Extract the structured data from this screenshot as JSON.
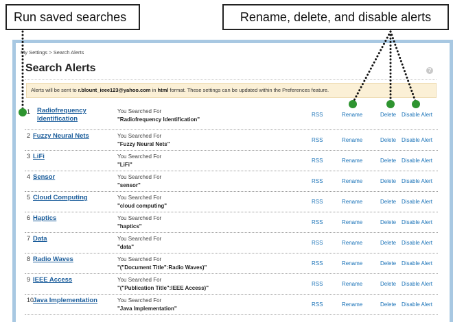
{
  "callouts": {
    "left": "Run saved searches",
    "right": "Rename, delete, and disable alerts"
  },
  "breadcrumb": "My Settings > Search Alerts",
  "title": "Search Alerts",
  "help_icon": "?",
  "notice": {
    "prefix": "Alerts will be sent to ",
    "email": "r.blount_ieee123@yahoo.com",
    "middle": " in ",
    "format": "html",
    "suffix": " format. These settings can be updated within the Preferences feature."
  },
  "actions": {
    "rss": "RSS",
    "rename": "Rename",
    "delete": "Delete",
    "disable": "Disable Alert"
  },
  "searched_label": "You Searched For",
  "alerts": [
    {
      "num": "1",
      "name": "Radiofrequency Identification",
      "query": "\"Radiofrequency Identification\""
    },
    {
      "num": "2",
      "name": "Fuzzy Neural Nets",
      "query": "\"Fuzzy Neural Nets\""
    },
    {
      "num": "3",
      "name": "LiFi",
      "query": "\"LiFi\""
    },
    {
      "num": "4",
      "name": "Sensor",
      "query": "\"sensor\""
    },
    {
      "num": "5",
      "name": "Cloud Computing",
      "query": "\"cloud computing\""
    },
    {
      "num": "6",
      "name": "Haptics",
      "query": "\"haptics\""
    },
    {
      "num": "7",
      "name": "Data",
      "query": "\"data\""
    },
    {
      "num": "8",
      "name": "Radio Waves",
      "query": "\"(\"Document Title\":Radio Waves)\""
    },
    {
      "num": "9",
      "name": "IEEE Access",
      "query": "\"(\"Publication Title\":IEEE Access)\""
    },
    {
      "num": "10",
      "name": "Java Implementation",
      "query": "\"Java Implementation\""
    }
  ],
  "colors": {
    "marker": "#2e9430",
    "link": "#1b5d9b",
    "frame": "#a8c8e2",
    "notice_bg": "#fbf0d6"
  }
}
